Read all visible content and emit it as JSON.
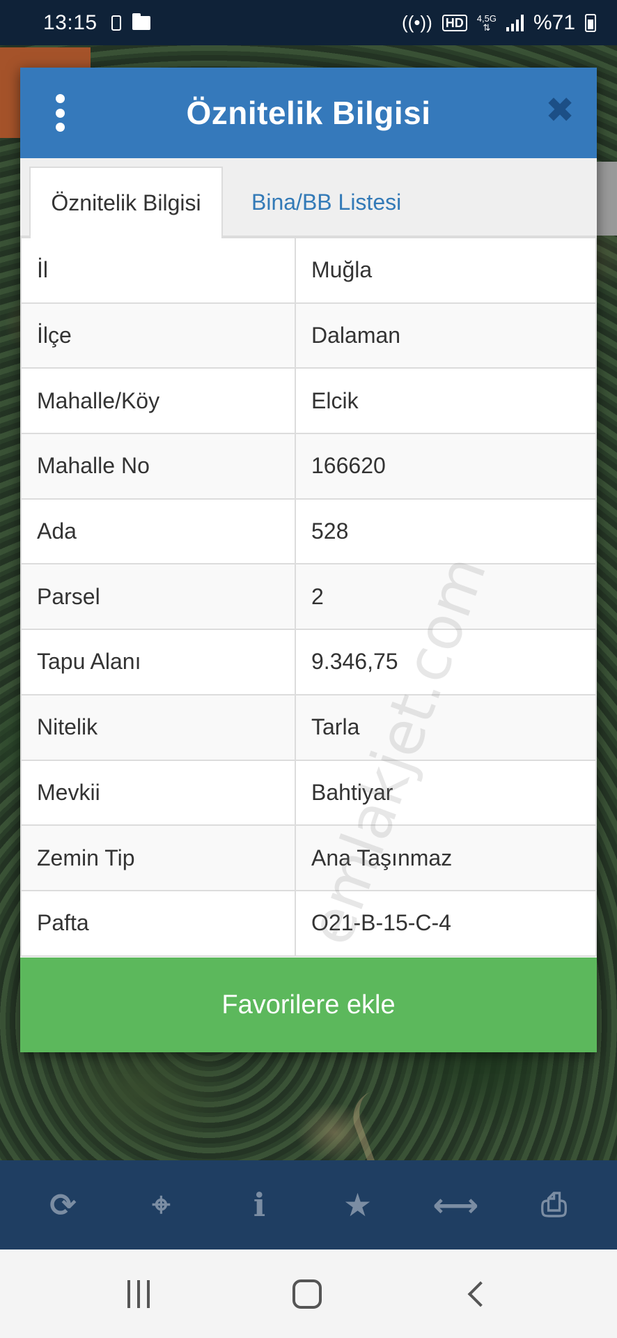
{
  "status_bar": {
    "time": "13:15",
    "battery_text": "%71",
    "network_label": "4,5G",
    "hd_label": "HD",
    "icons": [
      "phone-icon",
      "folder-icon",
      "hotspot-icon",
      "hd-voice-icon",
      "network-icon",
      "signal-icon",
      "battery-icon"
    ]
  },
  "modal": {
    "title": "Öznitelik Bilgisi",
    "menu_icon": "vertical-dots-icon",
    "close_icon": "close-icon",
    "tabs": [
      {
        "label": "Öznitelik Bilgisi",
        "active": true
      },
      {
        "label": "Bina/BB Listesi",
        "active": false
      }
    ],
    "rows": [
      {
        "key": "İl",
        "value": "Muğla"
      },
      {
        "key": "İlçe",
        "value": "Dalaman"
      },
      {
        "key": "Mahalle/Köy",
        "value": "Elcik"
      },
      {
        "key": "Mahalle No",
        "value": "166620"
      },
      {
        "key": "Ada",
        "value": "528"
      },
      {
        "key": "Parsel",
        "value": "2"
      },
      {
        "key": "Tapu Alanı",
        "value": "9.346,75"
      },
      {
        "key": "Nitelik",
        "value": "Tarla"
      },
      {
        "key": "Mevkii",
        "value": "Bahtiyar"
      },
      {
        "key": "Zemin Tip",
        "value": "Ana Taşınmaz"
      },
      {
        "key": "Pafta",
        "value": "O21-B-15-C-4"
      }
    ],
    "favorite_button": "Favorilere ekle"
  },
  "watermark": "emlakjet.com",
  "toolbar": {
    "icons": [
      "refresh-icon",
      "locate-icon",
      "info-icon",
      "star-icon",
      "measure-icon",
      "print-icon"
    ]
  },
  "nav_bar": {
    "icons": [
      "recent-apps-icon",
      "home-icon",
      "back-icon"
    ]
  },
  "colors": {
    "header_blue": "#3579bb",
    "favorite_green": "#5cb85c",
    "toolbar_navy": "#1f3e62",
    "tab_link_blue": "#337ab7"
  }
}
